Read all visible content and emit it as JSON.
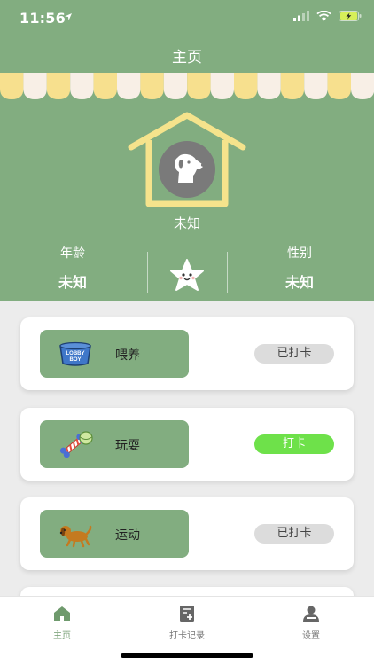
{
  "status_bar": {
    "time": "11:56"
  },
  "header": {
    "title": "主页"
  },
  "pet": {
    "name": "未知",
    "age_label": "年龄",
    "age_value": "未知",
    "gender_label": "性别",
    "gender_value": "未知",
    "avatar_icon": "dog-icon"
  },
  "tasks": [
    {
      "label": "喂养",
      "icon": "dog-food-bowl-icon",
      "button": "已打卡",
      "state": "done"
    },
    {
      "label": "玩耍",
      "icon": "toy-bone-icon",
      "button": "打卡",
      "state": "pending"
    },
    {
      "label": "运动",
      "icon": "running-dog-icon",
      "button": "已打卡",
      "state": "done"
    }
  ],
  "tabs": [
    {
      "label": "主页",
      "icon": "home-icon",
      "active": true
    },
    {
      "label": "打卡记录",
      "icon": "checkin-record-icon",
      "active": false
    },
    {
      "label": "设置",
      "icon": "settings-user-icon",
      "active": false
    }
  ],
  "colors": {
    "theme": "#82ad80",
    "accent": "#6ee14a",
    "house": "#f5e38c",
    "done_button": "#dcdcdc"
  }
}
